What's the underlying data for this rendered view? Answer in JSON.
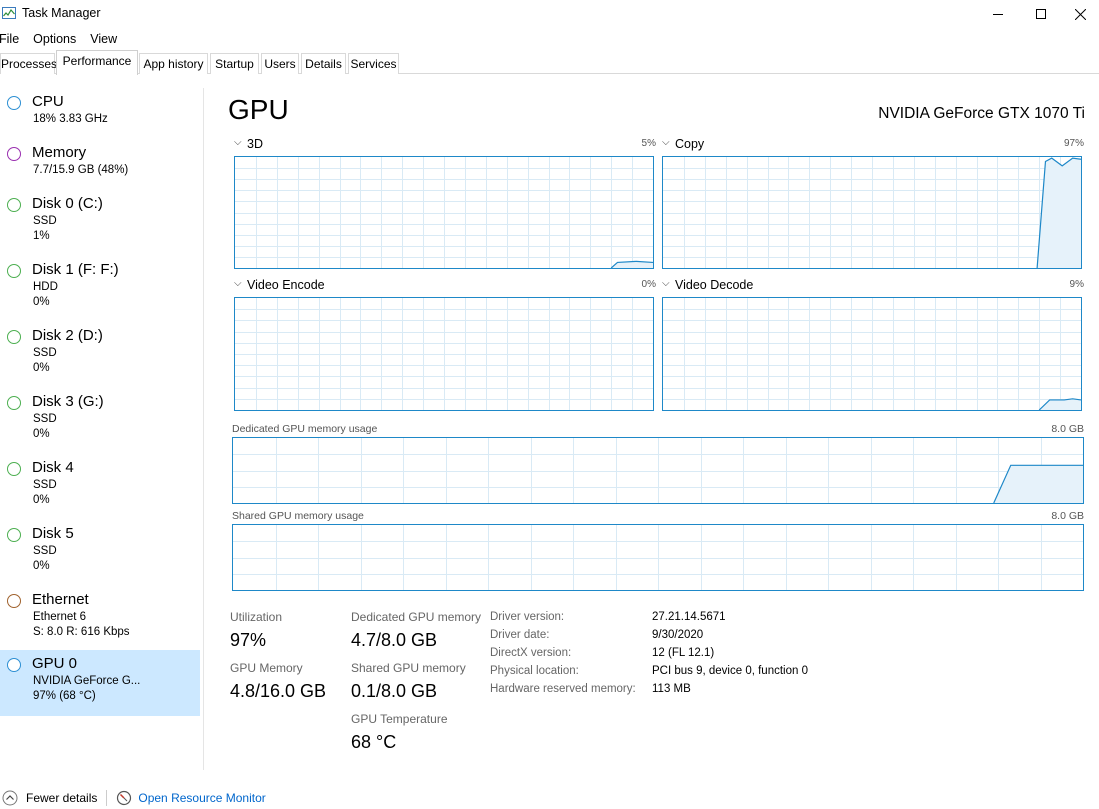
{
  "window": {
    "title": "Task Manager"
  },
  "menu": [
    "File",
    "Options",
    "View"
  ],
  "tabs": [
    "Processes",
    "Performance",
    "App history",
    "Startup",
    "Users",
    "Details",
    "Services"
  ],
  "sidebar": {
    "items": [
      {
        "name": "CPU",
        "lines": [
          "18%  3.83 GHz"
        ],
        "color": "#2c8fd3"
      },
      {
        "name": "Memory",
        "lines": [
          "7.7/15.9 GB (48%)"
        ],
        "color": "#9a2fb0"
      },
      {
        "name": "Disk 0 (C:)",
        "lines": [
          "SSD",
          "1%"
        ],
        "color": "#4caf50"
      },
      {
        "name": "Disk 1 (F: F:)",
        "lines": [
          "HDD",
          "0%"
        ],
        "color": "#4caf50"
      },
      {
        "name": "Disk 2 (D:)",
        "lines": [
          "SSD",
          "0%"
        ],
        "color": "#4caf50"
      },
      {
        "name": "Disk 3 (G:)",
        "lines": [
          "SSD",
          "0%"
        ],
        "color": "#4caf50"
      },
      {
        "name": "Disk 4",
        "lines": [
          "SSD",
          "0%"
        ],
        "color": "#4caf50"
      },
      {
        "name": "Disk 5",
        "lines": [
          "SSD",
          "0%"
        ],
        "color": "#4caf50"
      },
      {
        "name": "Ethernet",
        "lines": [
          "Ethernet 6",
          "S: 8.0  R: 616 Kbps"
        ],
        "color": "#a0622d"
      },
      {
        "name": "GPU 0",
        "lines": [
          "NVIDIA GeForce G...",
          "97%  (68 °C)"
        ],
        "color": "#2c8fd3"
      }
    ]
  },
  "main": {
    "title": "GPU",
    "model": "NVIDIA GeForce GTX 1070 Ti",
    "engines": [
      {
        "label": "3D",
        "percent": "5%"
      },
      {
        "label": "Copy",
        "percent": "97%"
      },
      {
        "label": "Video Encode",
        "percent": "0%"
      },
      {
        "label": "Video Decode",
        "percent": "9%"
      }
    ],
    "dedicated_label": "Dedicated GPU memory usage",
    "dedicated_max": "8.0 GB",
    "shared_label": "Shared GPU memory usage",
    "shared_max": "8.0 GB",
    "stats": {
      "utilization_label": "Utilization",
      "utilization_value": "97%",
      "dedicated_label": "Dedicated GPU memory",
      "dedicated_value": "4.7/8.0 GB",
      "gpu_memory_label": "GPU Memory",
      "gpu_memory_value": "4.8/16.0 GB",
      "shared_label": "Shared GPU memory",
      "shared_value": "0.1/8.0 GB",
      "temperature_label": "GPU Temperature",
      "temperature_value": "68 °C"
    },
    "info": [
      {
        "label": "Driver version:",
        "value": "27.21.14.5671"
      },
      {
        "label": "Driver date:",
        "value": "9/30/2020"
      },
      {
        "label": "DirectX version:",
        "value": "12 (FL 12.1)"
      },
      {
        "label": "Physical location:",
        "value": "PCI bus 9, device 0, function 0"
      },
      {
        "label": "Hardware reserved memory:",
        "value": "113 MB"
      }
    ]
  },
  "footer": {
    "fewer_details": "Fewer details",
    "open_resource_monitor": "Open Resource Monitor"
  },
  "colors": {
    "accent": "#1e88c8",
    "selected": "#cce8ff",
    "link": "#0066cc"
  }
}
